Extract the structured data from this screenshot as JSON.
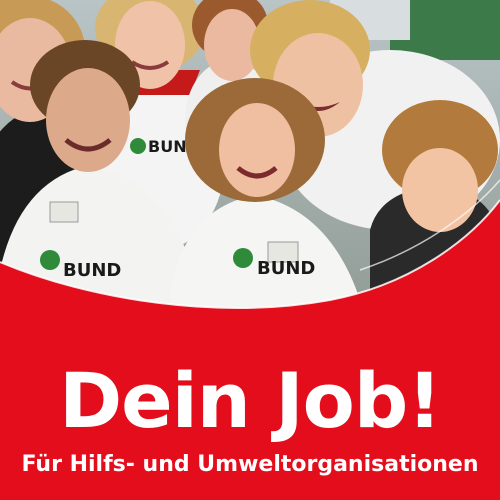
{
  "poster": {
    "headline": "Dein Job!",
    "subline": "Für Hilfs- und Umweltorganisationen"
  },
  "photo": {
    "description_icon": "group-of-young-people-photo",
    "shirt_logos": [
      "BUND",
      "BUND",
      "BUND"
    ]
  },
  "colors": {
    "brand_red": "#e30d1b",
    "text": "#ffffff",
    "shirt": "#f2f2f0",
    "bund_green": "#2f8a3a"
  }
}
